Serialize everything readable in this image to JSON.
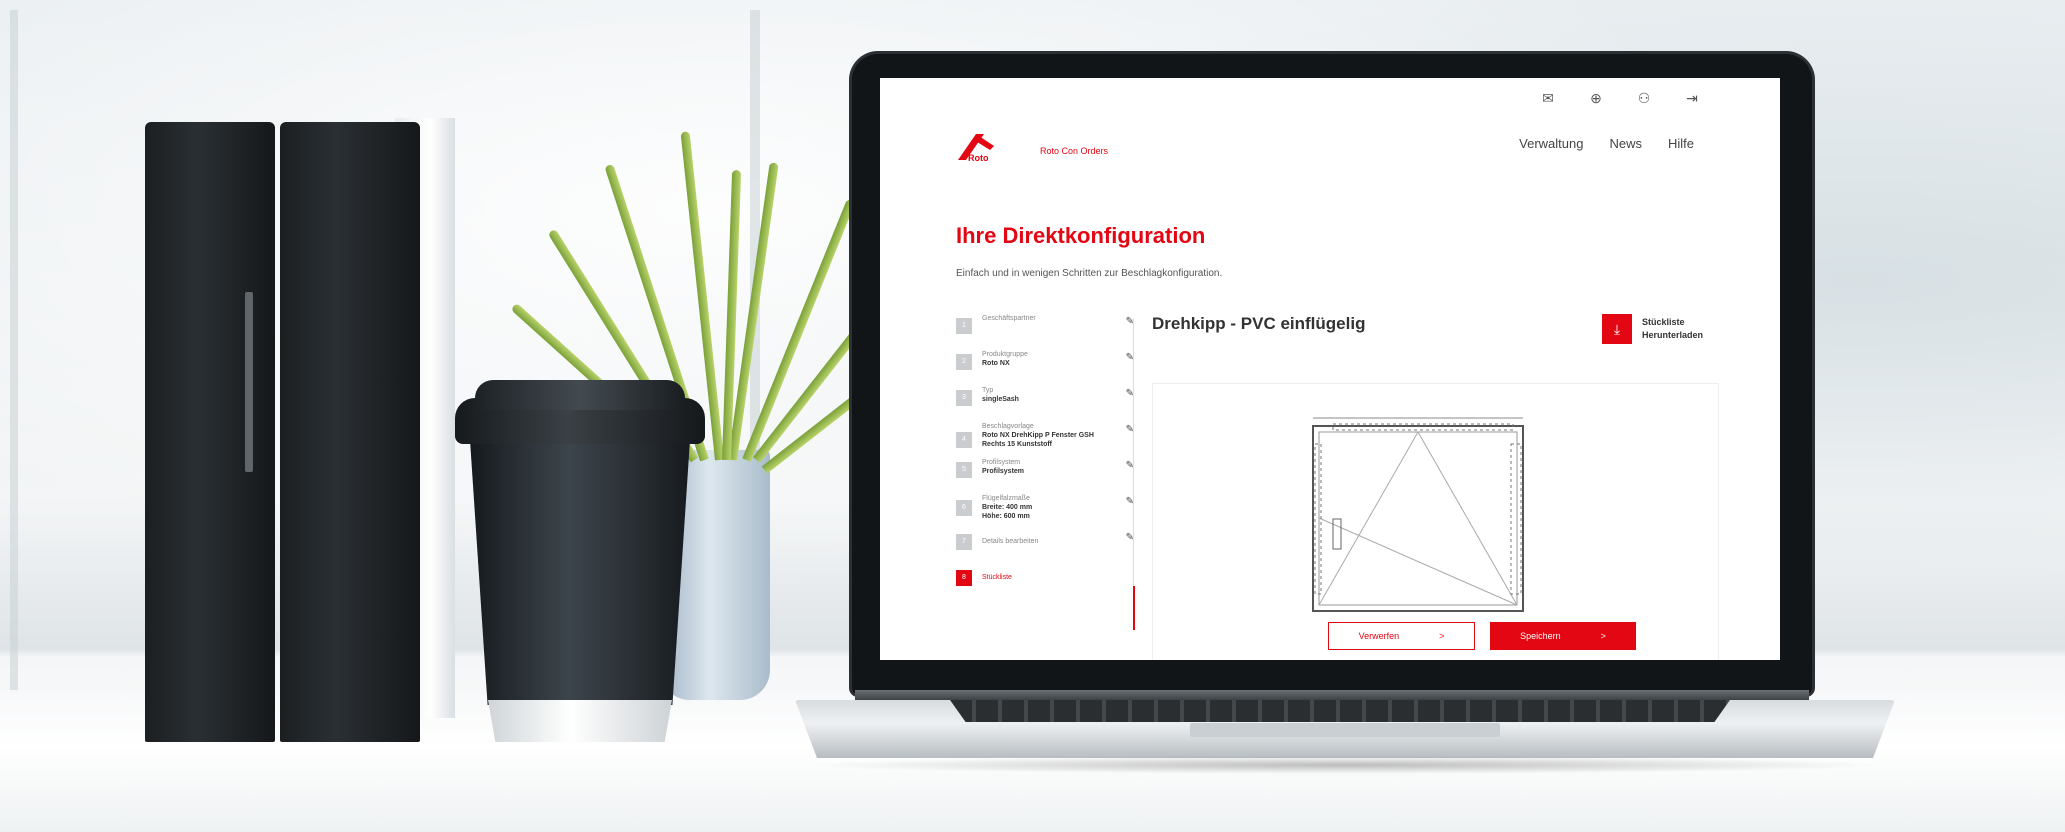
{
  "header": {
    "icons": [
      "mail-icon",
      "globe-icon",
      "user-icon",
      "logout-icon"
    ],
    "logo_text": "Roto",
    "brand": "Roto Con Orders",
    "nav": [
      "Verwaltung",
      "News",
      "Hilfe"
    ]
  },
  "page": {
    "title": "Ihre Direktkonfiguration",
    "subtitle": "Einfach und in wenigen Schritten zur Beschlagkonfiguration."
  },
  "steps": [
    {
      "num": "1",
      "label": "Geschäftspartner",
      "value": ""
    },
    {
      "num": "2",
      "label": "Produktgruppe",
      "value": "Roto NX"
    },
    {
      "num": "3",
      "label": "Typ",
      "value": "singleSash"
    },
    {
      "num": "4",
      "label": "Beschlagvorlage",
      "value": "Roto NX DrehKipp P Fenster GSH Rechts 15 Kunststoff"
    },
    {
      "num": "5",
      "label": "Profilsystem",
      "value": "Profilsystem"
    },
    {
      "num": "6",
      "label": "Flügelfalzmaße",
      "value": "Breite: 400 mm Höhe: 600 mm"
    },
    {
      "num": "7",
      "label": "Details bearbeiten",
      "value": ""
    },
    {
      "num": "8",
      "label": "Stückliste",
      "value": ""
    }
  ],
  "config": {
    "title": "Drehkipp  - PVC einflügelig",
    "download_label_1": "Stückliste",
    "download_label_2": "Herunterladen"
  },
  "actions": {
    "discard": "Verwerfen",
    "save": "Speichern",
    "arrow": ">"
  },
  "colors": {
    "accent": "#e30613"
  }
}
